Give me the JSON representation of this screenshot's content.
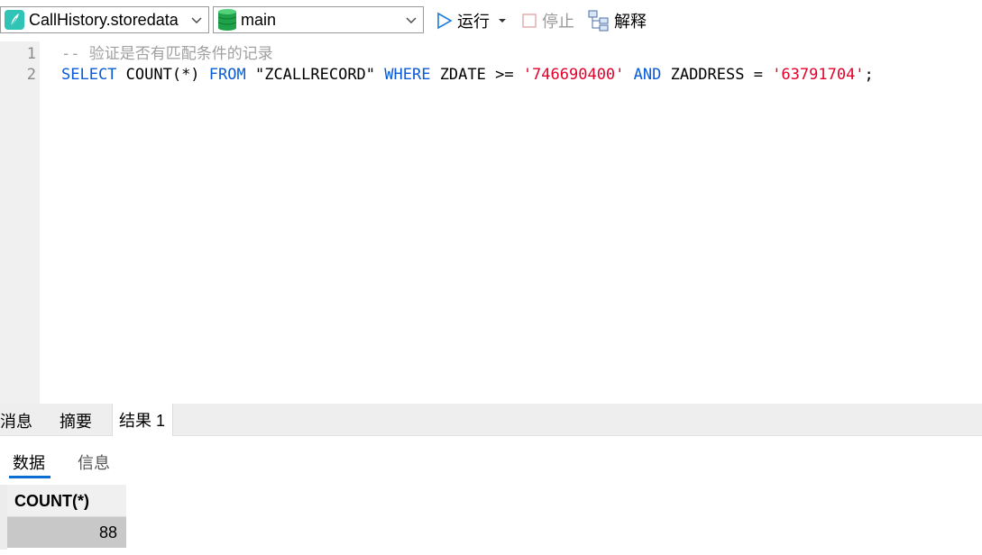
{
  "toolbar": {
    "database": "CallHistory.storedata",
    "schema": "main",
    "run_label": "运行",
    "stop_label": "停止",
    "explain_label": "解释"
  },
  "editor": {
    "line_numbers": [
      "1",
      "2"
    ],
    "line1": {
      "comment": "-- 验证是否有匹配条件的记录"
    },
    "line2": {
      "select_kw": "SELECT",
      "count_fn": " COUNT(*) ",
      "from_kw": "FROM",
      "table_name": " \"ZCALLRECORD\" ",
      "where_kw": "WHERE",
      "cond1": " ZDATE >= ",
      "val1": "'746690400'",
      "and_kw": " AND",
      "cond2": " ZADDRESS = ",
      "val2": "'63791704'",
      "terminator": ";"
    }
  },
  "result_tabs": [
    "消息",
    "摘要",
    "结果 1"
  ],
  "sub_tabs": [
    "数据",
    "信息"
  ],
  "grid": {
    "column": "COUNT(*)",
    "value": "88"
  },
  "colors": {
    "keyword": "#0a5bd6",
    "string": "#e4002b",
    "comment": "#a0a0a0",
    "accent": "#0a6fd0"
  },
  "icons": {
    "database": "notebook-icon",
    "schema": "database-cylinder-icon",
    "run": "play-icon",
    "stop": "stop-icon",
    "explain": "explain-tree-icon"
  }
}
